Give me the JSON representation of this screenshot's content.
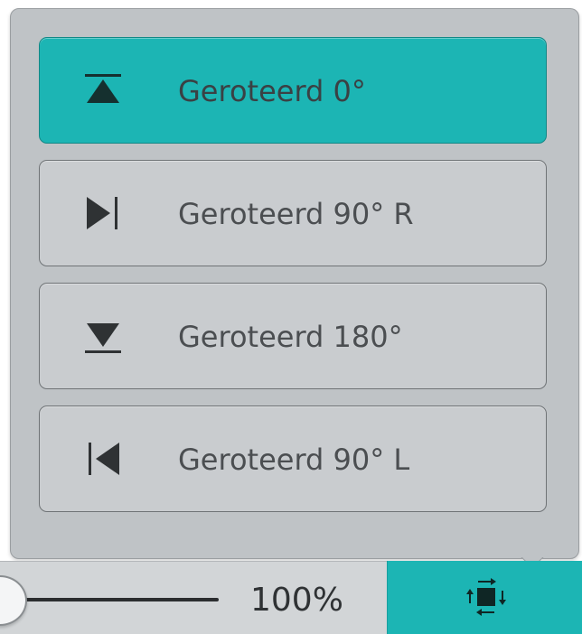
{
  "rotation_menu": {
    "options": [
      {
        "label": "Geroteerd 0°",
        "icon": "rotate-0-icon",
        "selected": true
      },
      {
        "label": "Geroteerd 90° R",
        "icon": "rotate-90-right-icon",
        "selected": false
      },
      {
        "label": "Geroteerd 180°",
        "icon": "rotate-180-icon",
        "selected": false
      },
      {
        "label": "Geroteerd 90° L",
        "icon": "rotate-90-left-icon",
        "selected": false
      }
    ]
  },
  "bottom_bar": {
    "zoom_value": "100%",
    "zoom_slider_level": 0.0,
    "rotate_button_icon": "rotate-design-icon"
  },
  "colors": {
    "accent": "#1cb5b4",
    "popup_background": "#bfc3c6",
    "option_background": "#c9cccf",
    "text": "#4b4e51"
  }
}
